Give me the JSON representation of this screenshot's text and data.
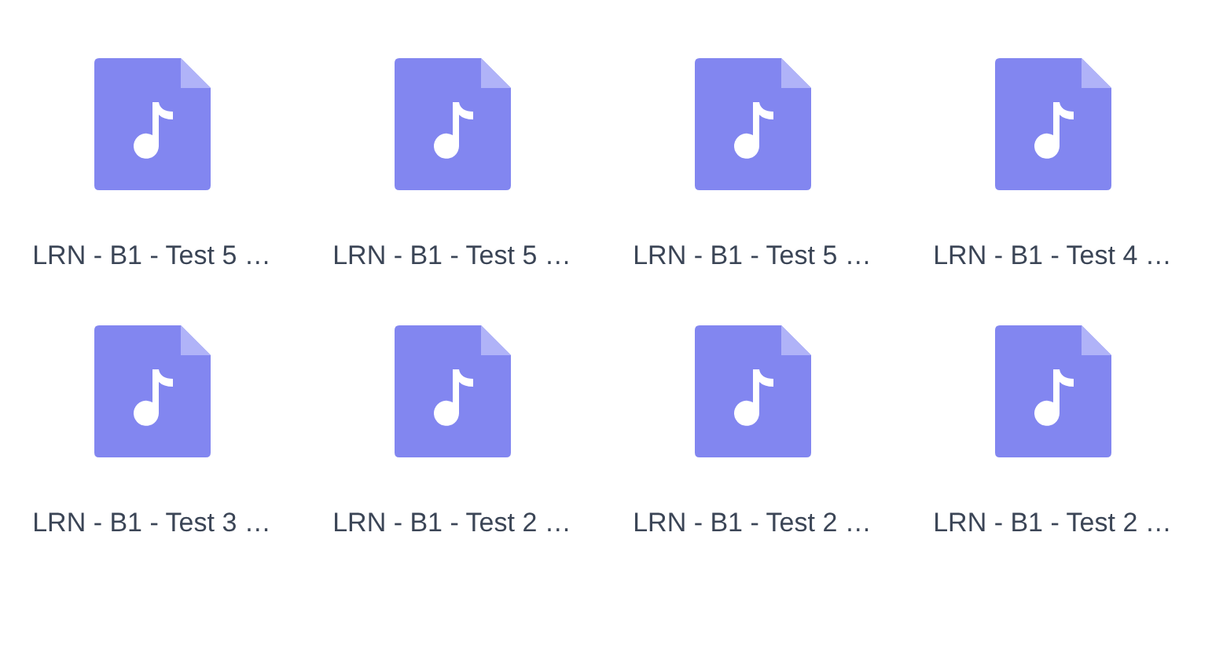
{
  "files": [
    {
      "name": "LRN - B1 - Test 5 …"
    },
    {
      "name": "LRN - B1 - Test 5 …"
    },
    {
      "name": "LRN - B1 - Test 5 …"
    },
    {
      "name": "LRN - B1 - Test 4 …"
    },
    {
      "name": "LRN - B1 - Test 3 …"
    },
    {
      "name": "LRN - B1 - Test 2 …"
    },
    {
      "name": "LRN - B1 - Test 2 …"
    },
    {
      "name": "LRN - B1 - Test 2 …"
    }
  ]
}
